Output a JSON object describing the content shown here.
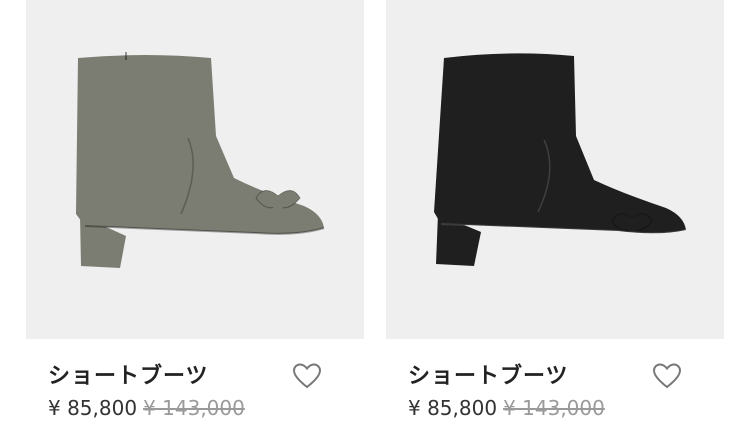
{
  "products": [
    {
      "name": "ショートブーツ",
      "price": "¥ 85,800",
      "original_price": "¥ 143,000",
      "boot_color": "#7b7d72",
      "image_icon": "boot-image",
      "favorite_icon": "heart-outline-icon"
    },
    {
      "name": "ショートブーツ",
      "price": "¥ 85,800",
      "original_price": "¥ 143,000",
      "boot_color": "#1f1f1f",
      "image_icon": "boot-image",
      "favorite_icon": "heart-outline-icon"
    }
  ],
  "colors": {
    "card_background": "#efefef",
    "text": "#222222",
    "strikethrough": "#9a9a9a"
  }
}
